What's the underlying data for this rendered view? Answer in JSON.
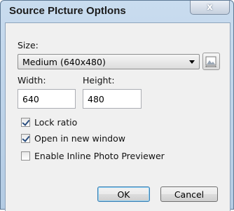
{
  "dialog": {
    "title": "Source PIcture Optlons",
    "close_glyph": "x"
  },
  "size": {
    "label": "Size:",
    "selected": "Medium (640x480)",
    "preview_icon": "image-resize-icon"
  },
  "width": {
    "label": "Width:",
    "value": "640"
  },
  "height": {
    "label": "Height:",
    "value": "480"
  },
  "options": [
    {
      "label": "Lock ratio",
      "checked": true
    },
    {
      "label": "Open in new window",
      "checked": true
    },
    {
      "label": "Enable Inline Photo Previewer",
      "checked": false
    }
  ],
  "buttons": {
    "ok": "OK",
    "cancel": "Cancel"
  },
  "colors": {
    "accent": "#3c7fb1",
    "title_bar": "#c9dcef",
    "client_bg": "#f0f0f0"
  }
}
